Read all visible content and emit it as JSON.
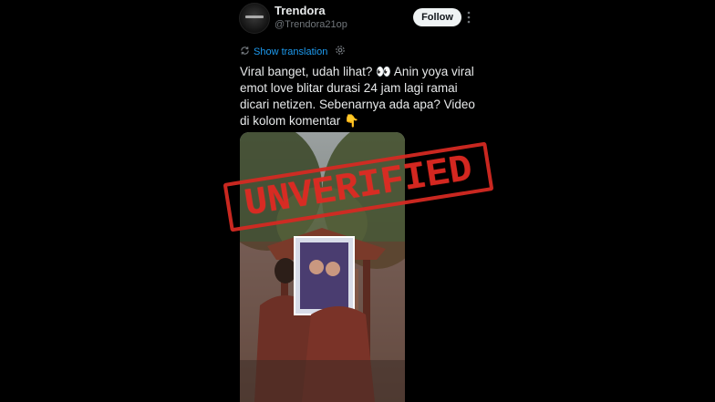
{
  "post": {
    "display_name": "Trendora",
    "handle": "@Trendora21op",
    "follow_label": "Follow",
    "translate_label": "Show translation",
    "text": "Viral banget, udah lihat? 👀 Anin yoya viral emot love blitar durasi 24 jam lagi ramai dicari netizen. Sebenarnya ada apa? Video di kolom komentar 👇"
  },
  "overlay": {
    "stamp_text": "UNVERIFIED",
    "stamp_color": "#d42a22"
  },
  "icons": {
    "avatar": "avatar-logo",
    "more": "more-dots-icon",
    "translate": "translate-icon",
    "settings": "gear-icon"
  },
  "colors": {
    "background": "#000000",
    "text": "#e7e9ea",
    "muted": "#71767b",
    "link": "#1d9bf0",
    "follow_bg": "#eff3f4"
  }
}
